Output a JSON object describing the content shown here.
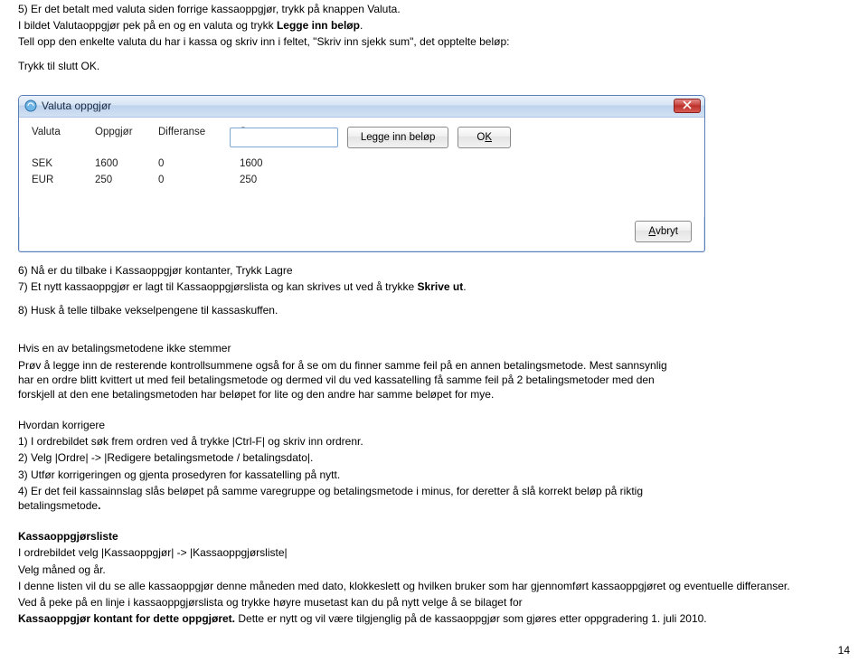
{
  "intro": {
    "line1": "5) Er det betalt med valuta siden forrige kassaoppgjør, trykk på knappen Valuta.",
    "line2a": "I bildet Valutaoppgjør pek på en og en valuta og trykk ",
    "line2b": "Legge inn beløp",
    "line2c": ".",
    "line3": "Tell opp den enkelte valuta du har i kassa og skriv inn i feltet, \"Skriv inn sjekk sum\", det opptelte beløp:",
    "line4": "Trykk til slutt OK."
  },
  "dialog": {
    "title": "Valuta oppgjør",
    "headers": {
      "valuta": "Valuta",
      "oppgjor": "Oppgjør",
      "diff": "Differanse",
      "sum": "Sum"
    },
    "rows": [
      {
        "valuta": "SEK",
        "oppgjor": "1600",
        "diff": "0",
        "sum": "1600"
      },
      {
        "valuta": "EUR",
        "oppgjor": "250",
        "diff": "0",
        "sum": "250"
      }
    ],
    "btn_legg": "Legge inn beløp",
    "btn_ok_text": "O",
    "btn_ok_ul": "K",
    "btn_avbryt_a": "A",
    "btn_avbryt_rest": "vbryt"
  },
  "mid": {
    "line6": "6) Nå er du tilbake i Kassaoppgjør kontanter, Trykk Lagre",
    "line7a": "7) Et nytt kassaoppgjør er lagt til Kassaoppgjørslista og kan skrives ut ved å trykke ",
    "line7b": "Skrive ut",
    "line7c": ".",
    "line8": "8) Husk å telle tilbake vekselpengene til kassaskuffen."
  },
  "mismatch": {
    "heading": "Hvis en av betalingsmetodene ikke stemmer",
    "p1": "Prøv å legge inn de resterende kontrollsummene også for å se om du finner samme feil på en annen betalingsmetode. Mest sannsynlig har en ordre blitt kvittert ut med feil betalingsmetode og dermed vil du ved kassatelling få samme feil på 2 betalingsmetoder med den forskjell at den ene betalingsmetoden har beløpet for lite og den andre har samme beløpet for mye."
  },
  "correct": {
    "heading": "Hvordan korrigere",
    "l1": "1) I ordrebildet søk frem ordren ved å trykke |Ctrl-F| og skriv inn ordrenr.",
    "l2": "2) Velg |Ordre| -> |Redigere betalingsmetode / betalingsdato|.",
    "l3": "3) Utfør korrigeringen og gjenta prosedyren for kassatelling på nytt.",
    "l4a": "4) Er det feil kassainnslag slås beløpet på samme varegruppe og betalingsmetode i minus, for deretter å slå korrekt beløp på riktig betalingsmetode",
    "l4b": "."
  },
  "list": {
    "heading": "Kassaoppgjørsliste",
    "l1": "I ordrebildet velg |Kassaoppgjør| -> |Kassaoppgjørsliste|",
    "l2": "Velg måned og år.",
    "l3": "I denne listen vil du se alle kassaoppgjør denne måneden med dato, klokkeslett og hvilken bruker som har gjennomført kassaoppgjøret og eventuelle differanser.",
    "l4": "Ved å peke på en linje i kassaoppgjørslista og trykke høyre musetast kan du på nytt velge å se bilaget for",
    "l5a": "Kassaoppgjør kontant for dette oppgjøret.",
    "l5b": " Dette er nytt og vil være tilgjenglig på de kassaoppgjør som gjøres etter oppgradering 1. juli 2010."
  },
  "page_number": "14"
}
